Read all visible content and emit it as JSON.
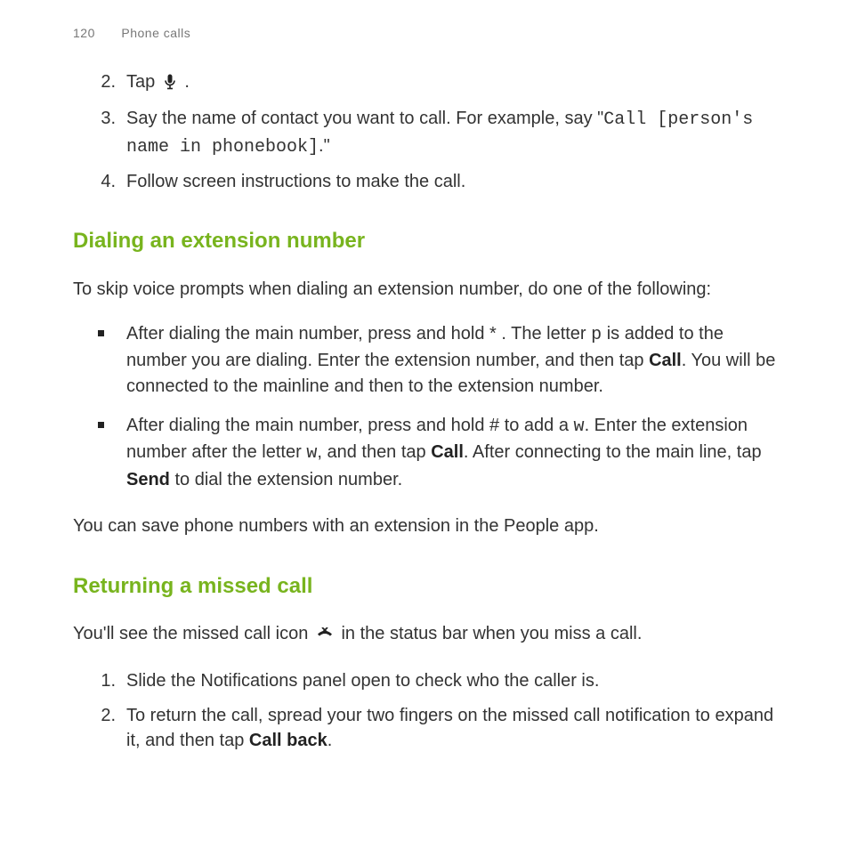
{
  "header": {
    "page_number": "120",
    "section": "Phone calls"
  },
  "steps_top": {
    "s2_prefix": "Tap ",
    "s2_suffix": " .",
    "s3_a": "Say the name of contact you want to call. For example, say \"",
    "s3_code": "Call [person's name in phonebook]",
    "s3_b": ".\"",
    "s4": "Follow screen instructions to make the call."
  },
  "dial_ext": {
    "heading": "Dialing an extension number",
    "intro": "To skip voice prompts when dialing an extension number, do one of the following:",
    "b1_a": "After dialing the main number, press and hold * . The letter ",
    "b1_p": "p",
    "b1_b": " is added to the number you are dialing. Enter the extension number, and then tap ",
    "b1_call": "Call",
    "b1_c": ". You will be connected to the mainline and then to the extension number.",
    "b2_a": "After dialing the main number, press and hold # to add a ",
    "b2_w1": "w",
    "b2_b": ". Enter the extension number after the letter ",
    "b2_w2": "w",
    "b2_c": ", and then tap ",
    "b2_call": "Call",
    "b2_d": ". After connecting to the main line, tap ",
    "b2_send": "Send",
    "b2_e": " to dial the extension number.",
    "outro": "You can save phone numbers with an extension in the People app."
  },
  "missed": {
    "heading": "Returning a missed call",
    "intro_a": "You'll see the missed call icon ",
    "intro_b": " in the status bar when you miss a call.",
    "s1": "Slide the Notifications panel open to check who the caller is.",
    "s2_a": "To return the call, spread your two fingers on the missed call notification to expand it, and then tap ",
    "s2_callback": "Call back",
    "s2_b": "."
  }
}
